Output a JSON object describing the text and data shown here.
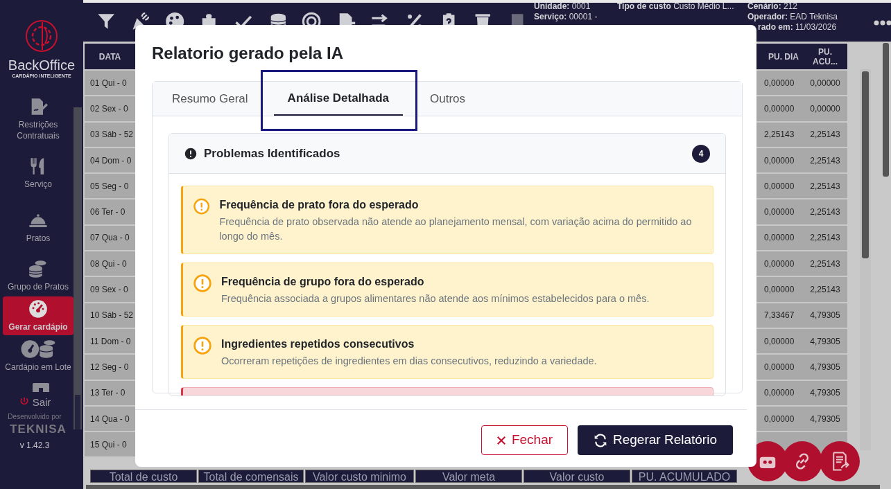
{
  "sidebar": {
    "brand": "BackOffice",
    "tagline": "CARDÁPIO INTELIGENTE",
    "items": [
      {
        "label": "Restrições Contratuais",
        "selected": false
      },
      {
        "label": "Serviço",
        "selected": false
      },
      {
        "label": "Pratos",
        "selected": false
      },
      {
        "label": "Grupo de Pratos",
        "selected": false
      },
      {
        "label": "Gerar cardápio",
        "selected": true
      },
      {
        "label": "Cardápio em Lote",
        "selected": false
      }
    ],
    "logout": "Sair",
    "credit": "Desenvolvido por",
    "company": "TEKNISA",
    "version": "v 1.42.3"
  },
  "header": {
    "columns": [
      [
        {
          "label": "Unidade:",
          "value": "0001"
        },
        {
          "label": "Serviço:",
          "value": "00001 -"
        }
      ],
      [
        {
          "label": "Tipo de custo",
          "value": "Custo Médio L..."
        }
      ],
      [
        {
          "label": "Cenário:",
          "value": "212"
        },
        {
          "label": "Operador:",
          "value": "EAD Teknisa"
        },
        {
          "label": "rado em:",
          "value": "11/03/2026"
        }
      ]
    ]
  },
  "table": {
    "columns": [
      "DATA",
      "PU. DIA",
      "PU. ACU..."
    ],
    "rows": [
      {
        "date": "01 Qui - 0",
        "pu_dia": "0,00000",
        "pu_acumulado": "0,00000"
      },
      {
        "date": "02 Sex - 0",
        "pu_dia": "0,00000",
        "pu_acumulado": "0,00000"
      },
      {
        "date": "03 Sáb - 52",
        "pu_dia": "2,25143",
        "pu_acumulado": "2,25143"
      },
      {
        "date": "04 Dom - 0",
        "pu_dia": "0,00000",
        "pu_acumulado": "2,25143"
      },
      {
        "date": "05 Seg - 0",
        "pu_dia": "0,00000",
        "pu_acumulado": "2,25143"
      },
      {
        "date": "06 Ter - 0",
        "pu_dia": "0,00000",
        "pu_acumulado": "2,25143"
      },
      {
        "date": "07 Qua - 0",
        "pu_dia": "0,00000",
        "pu_acumulado": "2,25143"
      },
      {
        "date": "08 Qui - 0",
        "pu_dia": "0,00000",
        "pu_acumulado": "2,25143"
      },
      {
        "date": "09 Sex - 0",
        "pu_dia": "0,00000",
        "pu_acumulado": "2,25143"
      },
      {
        "date": "10 Sáb - 52",
        "pu_dia": "7,33467",
        "pu_acumulado": "4,79305"
      },
      {
        "date": "11 Dom - 0",
        "pu_dia": "0,00000",
        "pu_acumulado": "4,79305"
      },
      {
        "date": "12 Seg - 0",
        "pu_dia": "0,00000",
        "pu_acumulado": "4,79305"
      },
      {
        "date": "13 Ter - 0",
        "pu_dia": "0,00000",
        "pu_acumulado": "4,79305"
      },
      {
        "date": "14 Qua - 0",
        "pu_dia": "0,00000",
        "pu_acumulado": "4,79305"
      },
      {
        "date": "15 Qui - 0"
      }
    ]
  },
  "footer_tabs": [
    "Total de custo",
    "Total de comensais",
    "Valor custo minimo",
    "Valor meta",
    "Valor custo",
    "PU. ACUMULADO"
  ],
  "modal": {
    "title": "Relatorio gerado pela IA",
    "tabs": [
      {
        "label": "Resumo Geral",
        "selected": false
      },
      {
        "label": "Análise Detalhada",
        "selected": true
      },
      {
        "label": "Outros",
        "selected": false
      }
    ],
    "section": {
      "title": "Problemas Identificados",
      "count": "4",
      "items": [
        {
          "kind": "warning",
          "title": "Frequência de prato fora do esperado",
          "text": "Frequência de prato observada não atende ao planejamento mensal, com variação acima do permitido ao longo do mês."
        },
        {
          "kind": "warning",
          "title": "Frequência de grupo fora do esperado",
          "text": "Frequência associada a grupos alimentares não atende aos mínimos estabelecidos para o mês."
        },
        {
          "kind": "warning",
          "title": "Ingredientes repetidos consecutivos",
          "text": "Ocorreram repetições de ingredientes em dias consecutivos, reduzindo a variedade."
        },
        {
          "kind": "danger"
        }
      ]
    },
    "buttons": [
      {
        "kind": "cancel",
        "label": "Fechar"
      },
      {
        "kind": "primary",
        "label": "Regerar Relatório"
      }
    ]
  }
}
